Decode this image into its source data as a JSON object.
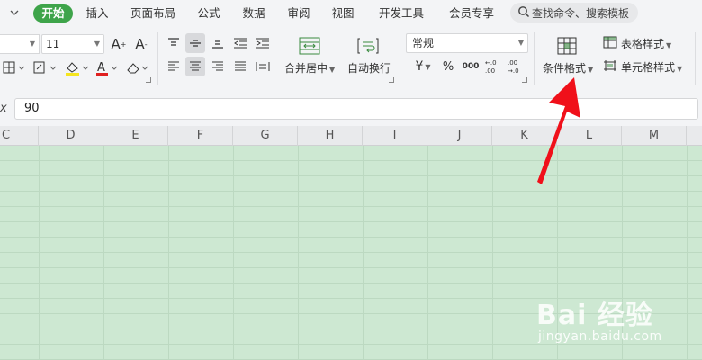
{
  "menu": {
    "tabs": [
      {
        "label": "开始",
        "active": true
      },
      {
        "label": "插入"
      },
      {
        "label": "页面布局"
      },
      {
        "label": "公式"
      },
      {
        "label": "数据"
      },
      {
        "label": "审阅"
      },
      {
        "label": "视图"
      },
      {
        "label": "开发工具"
      },
      {
        "label": "会员专享"
      }
    ],
    "search_placeholder": "查找命令、搜索模板"
  },
  "ribbon": {
    "font_size": "11",
    "number_format": "常规",
    "merge_label": "合并居中",
    "wrap_label": "自动换行",
    "conditional_format_label": "条件格式",
    "table_style_label": "表格样式",
    "cell_style_label": "单元格样式",
    "currency_symbol": "¥",
    "percent_symbol": "%",
    "thousands_symbol": "000",
    "increase_decimal": "+.0 .00",
    "decrease_decimal": ".00 →.0",
    "font_color": "#e02020",
    "fill_color": "#f5e51f"
  },
  "formula_bar": {
    "fx": "x",
    "value": "90"
  },
  "sheet": {
    "columns": [
      "C",
      "D",
      "E",
      "F",
      "G",
      "H",
      "I",
      "J",
      "K",
      "L",
      "M"
    ],
    "fill_color": "#cde8d2"
  },
  "annotation": {
    "arrow_color": "#f0101a"
  },
  "watermark": {
    "logo_text": "Bai 经验",
    "url": "jingyan.baidu.com"
  },
  "colors": {
    "accent": "#3ea44a",
    "ribbon_bg": "#f3f4f6"
  }
}
